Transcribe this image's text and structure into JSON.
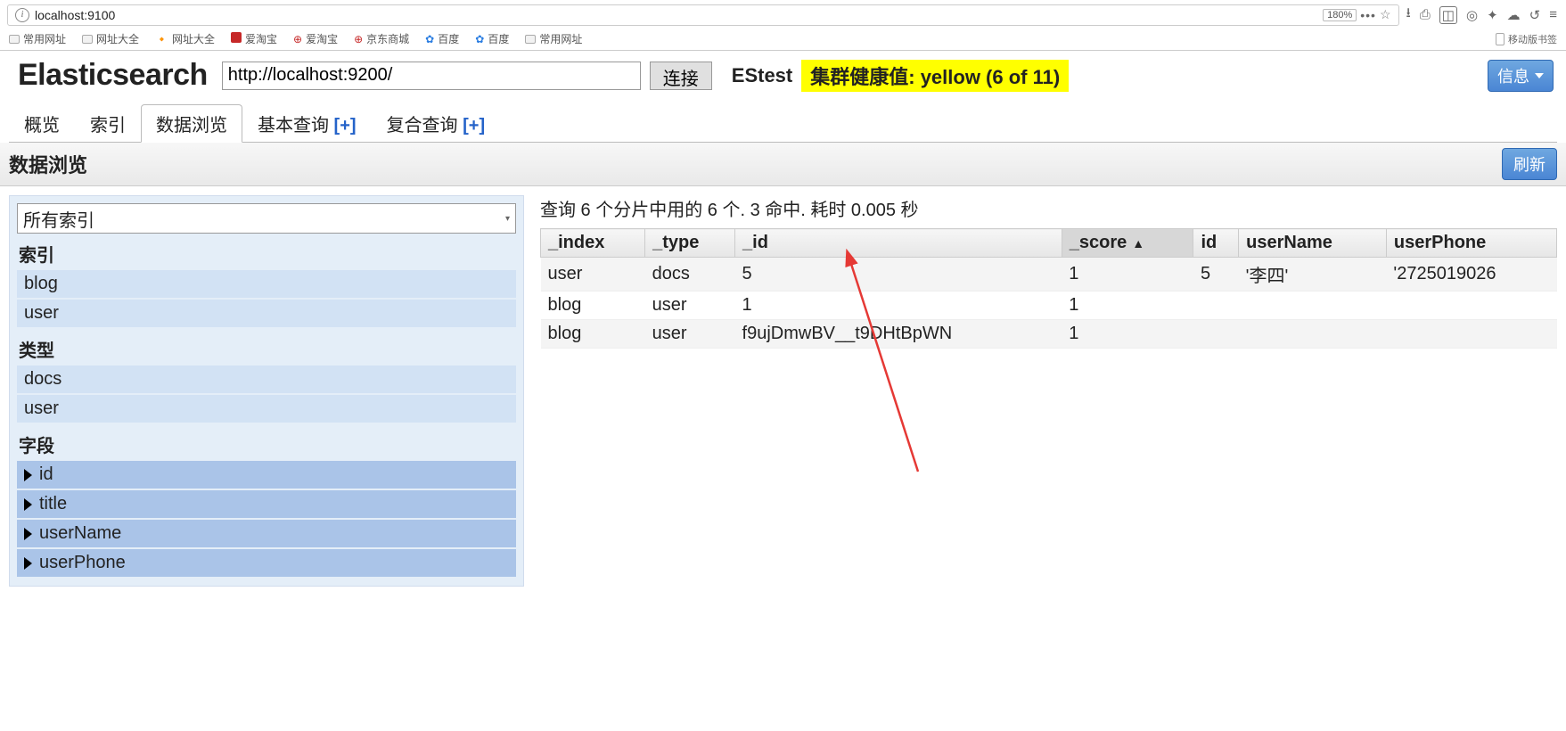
{
  "browser": {
    "url_display": "localhost:9100",
    "zoom": "180%",
    "bookmarks": [
      "常用网址",
      "网址大全",
      "网址大全",
      "爱淘宝",
      "爱淘宝",
      "京东商城",
      "百度",
      "百度",
      "常用网址"
    ],
    "mobile_bookmarks_label": "移动版书签"
  },
  "header": {
    "app_title": "Elasticsearch",
    "cluster_url": "http://localhost:9200/",
    "connect_label": "连接",
    "cluster_name": "EStest",
    "health_text": "集群健康值: yellow (6 of 11)",
    "info_label": "信息"
  },
  "tabs": {
    "items": [
      {
        "label": "概览",
        "plus": false
      },
      {
        "label": "索引",
        "plus": false
      },
      {
        "label": "数据浏览",
        "plus": false,
        "active": true
      },
      {
        "label": "基本查询",
        "plus": true
      },
      {
        "label": "复合查询",
        "plus": true
      }
    ],
    "plus_glyph": "[+]"
  },
  "subheader": {
    "title": "数据浏览",
    "refresh_label": "刷新"
  },
  "sidebar": {
    "index_select_label": "所有索引",
    "groups": [
      {
        "title": "索引",
        "style": "light",
        "items": [
          "blog",
          "user"
        ]
      },
      {
        "title": "类型",
        "style": "light",
        "items": [
          "docs",
          "user"
        ]
      },
      {
        "title": "字段",
        "style": "dark",
        "items": [
          "id",
          "title",
          "userName",
          "userPhone"
        ]
      }
    ]
  },
  "results": {
    "summary": "查询 6 个分片中用的 6 个. 3 命中. 耗时 0.005 秒",
    "columns": [
      "_index",
      "_type",
      "_id",
      "_score",
      "id",
      "userName",
      "userPhone"
    ],
    "sorted_column": 3,
    "sort_dir_glyph": "▲",
    "rows": [
      {
        "_index": "user",
        "_type": "docs",
        "_id": "5",
        "_score": "1",
        "id": "5",
        "userName": "'李四'",
        "userPhone": "'2725019026"
      },
      {
        "_index": "blog",
        "_type": "user",
        "_id": "1",
        "_score": "1",
        "id": "",
        "userName": "",
        "userPhone": ""
      },
      {
        "_index": "blog",
        "_type": "user",
        "_id": "f9ujDmwBV__t9DHtBpWN",
        "_score": "1",
        "id": "",
        "userName": "",
        "userPhone": ""
      }
    ]
  }
}
